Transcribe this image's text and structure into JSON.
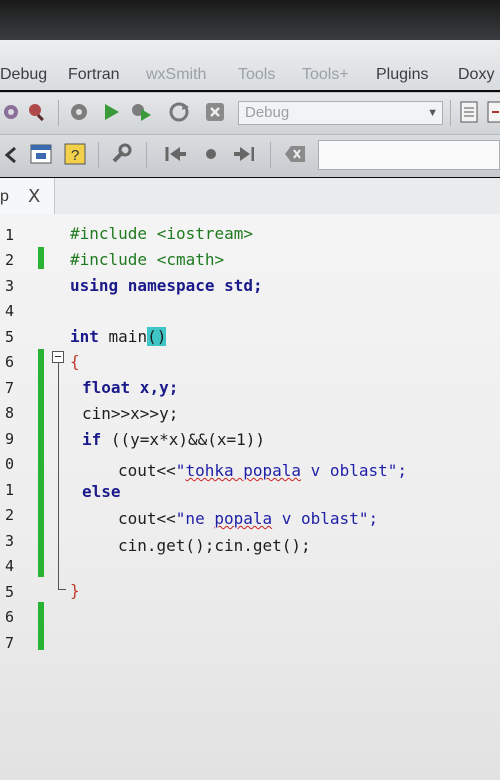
{
  "menu": {
    "items": [
      {
        "label": "Debug",
        "dim": false
      },
      {
        "label": "Fortran",
        "dim": false
      },
      {
        "label": "wxSmith",
        "dim": true
      },
      {
        "label": "Tools",
        "dim": true
      },
      {
        "label": "Tools+",
        "dim": true
      },
      {
        "label": "Plugins",
        "dim": false
      },
      {
        "label": "Doxy",
        "dim": false
      }
    ]
  },
  "toolbar": {
    "build_target": "Debug"
  },
  "tab": {
    "label": "p",
    "close": "X"
  },
  "editor": {
    "line_numbers": [
      "1",
      "2",
      "3",
      "4",
      "5",
      "6",
      "7",
      "8",
      "9",
      "0",
      "1",
      "2",
      "3",
      "4",
      "5",
      "6",
      "7"
    ],
    "lines": {
      "l1": "#include <iostream>",
      "l2": "#include <cmath>",
      "l3_kw": "using namespace",
      "l3_rest": " std;",
      "l5_kw": "int",
      "l5_name": " main",
      "l5_paren": "()",
      "l6": "{",
      "l7_kw": "float",
      "l7_rest": " x,y;",
      "l8": "cin>>x>>y;",
      "l9_kw": "if",
      "l9_rest": " ((y=x*x)&&(x=1))",
      "l10_a": "cout<<",
      "l10_b": "\"",
      "l10_c": "tohka popala",
      "l10_d": " v oblast\";",
      "l11_kw": "else",
      "l12_a": "cout<<",
      "l12_b": "\"ne ",
      "l12_c": "popala",
      "l12_d": " v oblast\";",
      "l13": "cin.get();cin.get();",
      "l15": "}"
    }
  }
}
